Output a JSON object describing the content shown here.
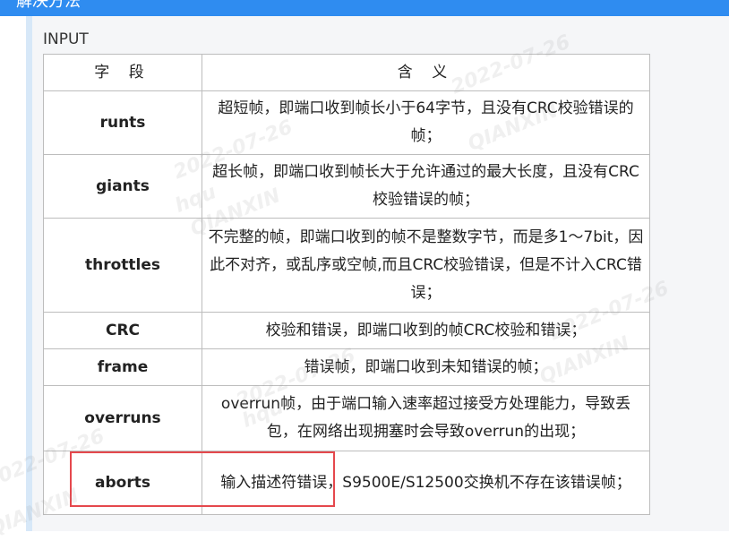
{
  "header": {
    "title": "解决方法"
  },
  "section": {
    "label": "INPUT"
  },
  "table": {
    "columns": [
      "字 段",
      "含 义"
    ],
    "rows": [
      {
        "name": "runts",
        "meaning": "超短帧，即端口收到帧长小于64字节，且没有CRC校验错误的帧；"
      },
      {
        "name": "giants",
        "meaning": "超长帧，即端口收到帧长大于允许通过的最大长度，且没有CRC校验错误的帧；"
      },
      {
        "name": "throttles",
        "meaning": "不完整的帧，即端口收到的帧不是整数字节，而是多1～7bit，因此不对齐，或乱序或空帧,而且CRC校验错误，但是不计入CRC错误；"
      },
      {
        "name": "CRC",
        "meaning": "校验和错误，即端口收到的帧CRC校验和错误；"
      },
      {
        "name": "frame",
        "meaning": "错误帧，即端口收到未知错误的帧；"
      },
      {
        "name": "overruns",
        "meaning": "overrun帧，由于端口输入速率超过接受方处理能力，导致丢包，在网络出现拥塞时会导致overrun的出现；"
      },
      {
        "name": "aborts",
        "meaning": "输入描述符错误，S9500E/S12500交换机不存在该错误帧；"
      }
    ]
  },
  "watermarks": [
    "2022-07-26",
    "QIANXIN",
    "hqu"
  ]
}
